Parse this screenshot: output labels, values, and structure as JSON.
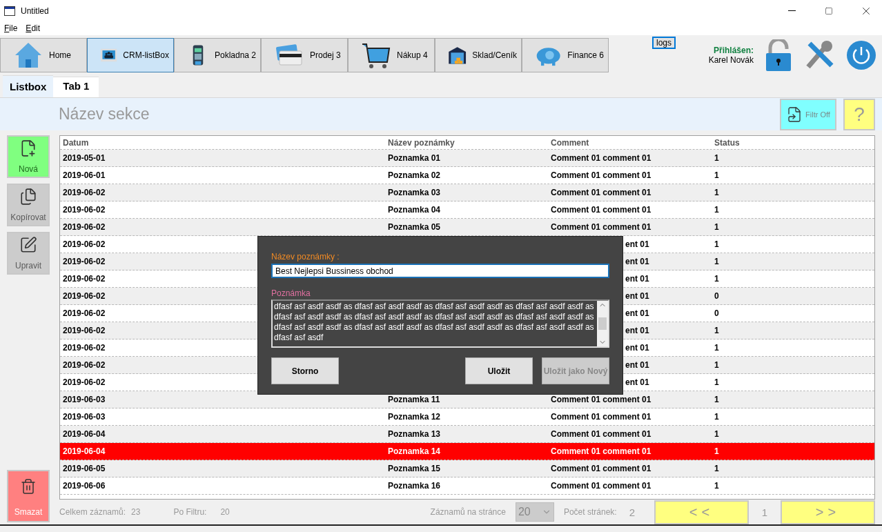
{
  "window": {
    "title": "Untitled"
  },
  "menu": [
    "File",
    "Edit"
  ],
  "toolbar": [
    {
      "label": "Home",
      "kind": "home",
      "selected": false
    },
    {
      "label": "CRM-listBox",
      "kind": "people",
      "selected": true
    },
    {
      "label": "Pokladna 2",
      "kind": "terminal",
      "selected": false
    },
    {
      "label": "Prodej 3",
      "kind": "card",
      "selected": false
    },
    {
      "label": "Nákup 4",
      "kind": "cart",
      "selected": false
    },
    {
      "label": "Sklad/Ceník",
      "kind": "warehouse",
      "selected": false
    },
    {
      "label": "Finance 6",
      "kind": "piggy",
      "selected": false
    }
  ],
  "logs_button": "logs",
  "user": {
    "label": "Přihlášen:",
    "name": "Karel Novák"
  },
  "tabs": [
    {
      "label": "Listbox",
      "selected": true
    },
    {
      "label": "Tab 1",
      "selected": false
    }
  ],
  "section": {
    "title": "Název sekce",
    "filter_button": "Filtr Off",
    "help_button": "?"
  },
  "side_actions": [
    {
      "label": "Nová",
      "kind": "new",
      "enabled": true
    },
    {
      "label": "Kopírovat",
      "kind": "copy",
      "enabled": false
    },
    {
      "label": "Upravit",
      "kind": "edit",
      "enabled": false
    }
  ],
  "delete_button": "Smazat",
  "table": {
    "columns": [
      "Datum",
      "Název poznámky",
      "Comment",
      "Status"
    ],
    "rows": [
      {
        "date": "2019-05-01",
        "name": "Poznamka 01",
        "comment": "Comment 01 comment 01",
        "status": "1",
        "selected": false
      },
      {
        "date": "2019-06-01",
        "name": "Poznamka 02",
        "comment": "Comment 01 comment 01",
        "status": "1",
        "selected": false
      },
      {
        "date": "2019-06-02",
        "name": "Poznamka 03",
        "comment": "Comment 01 comment 01",
        "status": "1",
        "selected": false
      },
      {
        "date": "2019-06-02",
        "name": "Poznamka 04",
        "comment": "Comment 01 comment 01",
        "status": "1",
        "selected": false
      },
      {
        "date": "2019-06-02",
        "name": "Poznamka 05",
        "comment": "Comment 01 comment 01",
        "status": "1",
        "selected": false
      },
      {
        "date": "2019-06-02",
        "comment": "ent 01",
        "status": "1",
        "selected": false
      },
      {
        "date": "2019-06-02",
        "comment": "ent 01",
        "status": "1",
        "selected": false
      },
      {
        "date": "2019-06-02",
        "comment": "ent 01",
        "status": "1",
        "selected": false
      },
      {
        "date": "2019-06-02",
        "comment": "ent 01",
        "status": "0",
        "selected": false
      },
      {
        "date": "2019-06-02",
        "comment": "ent 01",
        "status": "0",
        "selected": false
      },
      {
        "date": "2019-06-02",
        "comment": "ent 01",
        "status": "1",
        "selected": false
      },
      {
        "date": "2019-06-02",
        "comment": "ent 01",
        "status": "1",
        "selected": false
      },
      {
        "date": "2019-06-02",
        "comment": "ent 01",
        "status": "1",
        "selected": false
      },
      {
        "date": "2019-06-02",
        "comment": "ent 01",
        "status": "1",
        "selected": false
      },
      {
        "date": "2019-06-03",
        "name": "Poznamka 11",
        "comment": "Comment 01 comment 01",
        "status": "1",
        "selected": false
      },
      {
        "date": "2019-06-03",
        "name": "Poznamka 12",
        "comment": "Comment 01 comment 01",
        "status": "1",
        "selected": false
      },
      {
        "date": "2019-06-04",
        "name": "Poznamka 13",
        "comment": "Comment 01 comment 01",
        "status": "1",
        "selected": false
      },
      {
        "date": "2019-06-04",
        "name": "Poznamka 14",
        "comment": "Comment 01 comment 01",
        "status": "1",
        "selected": true
      },
      {
        "date": "2019-06-05",
        "name": "Poznamka 15",
        "comment": "Comment 01 comment 01",
        "status": "1",
        "selected": false
      },
      {
        "date": "2019-06-06",
        "name": "Poznamka 16",
        "comment": "Comment 01 comment 01",
        "status": "1",
        "selected": false
      }
    ]
  },
  "dialog": {
    "title_label": "Název poznámky :",
    "title_value": "Best Nejlepsi Bussiness obchod",
    "note_label": "Poznámka",
    "note_value": "dfasf asf asdf asdf as dfasf asf asdf asdf as dfasf asf asdf asdf as dfasf asf asdf asdf as dfasf asf asdf asdf as dfasf asf asdf asdf as dfasf asf asdf asdf as dfasf asf asdf asdf as dfasf asf asdf asdf as dfasf asf asdf asdf as dfasf asf asdf asdf as dfasf asf asdf asdf as dfasf asf asdf",
    "buttons": [
      {
        "label": "Storno",
        "disabled": false
      },
      {
        "label": "Uložit",
        "disabled": false
      },
      {
        "label": "Uložit jako Nový",
        "disabled": true
      }
    ]
  },
  "footer": {
    "total_label": "Celkem záznamů:",
    "total": "23",
    "filtered_label": "Po Filtru:",
    "filtered": "20",
    "per_page_label": "Záznamů na stránce",
    "per_page": "20",
    "pages_label": "Počet stránek:",
    "pages": "2",
    "prev": "<<",
    "page": "1",
    "next": ">>"
  }
}
